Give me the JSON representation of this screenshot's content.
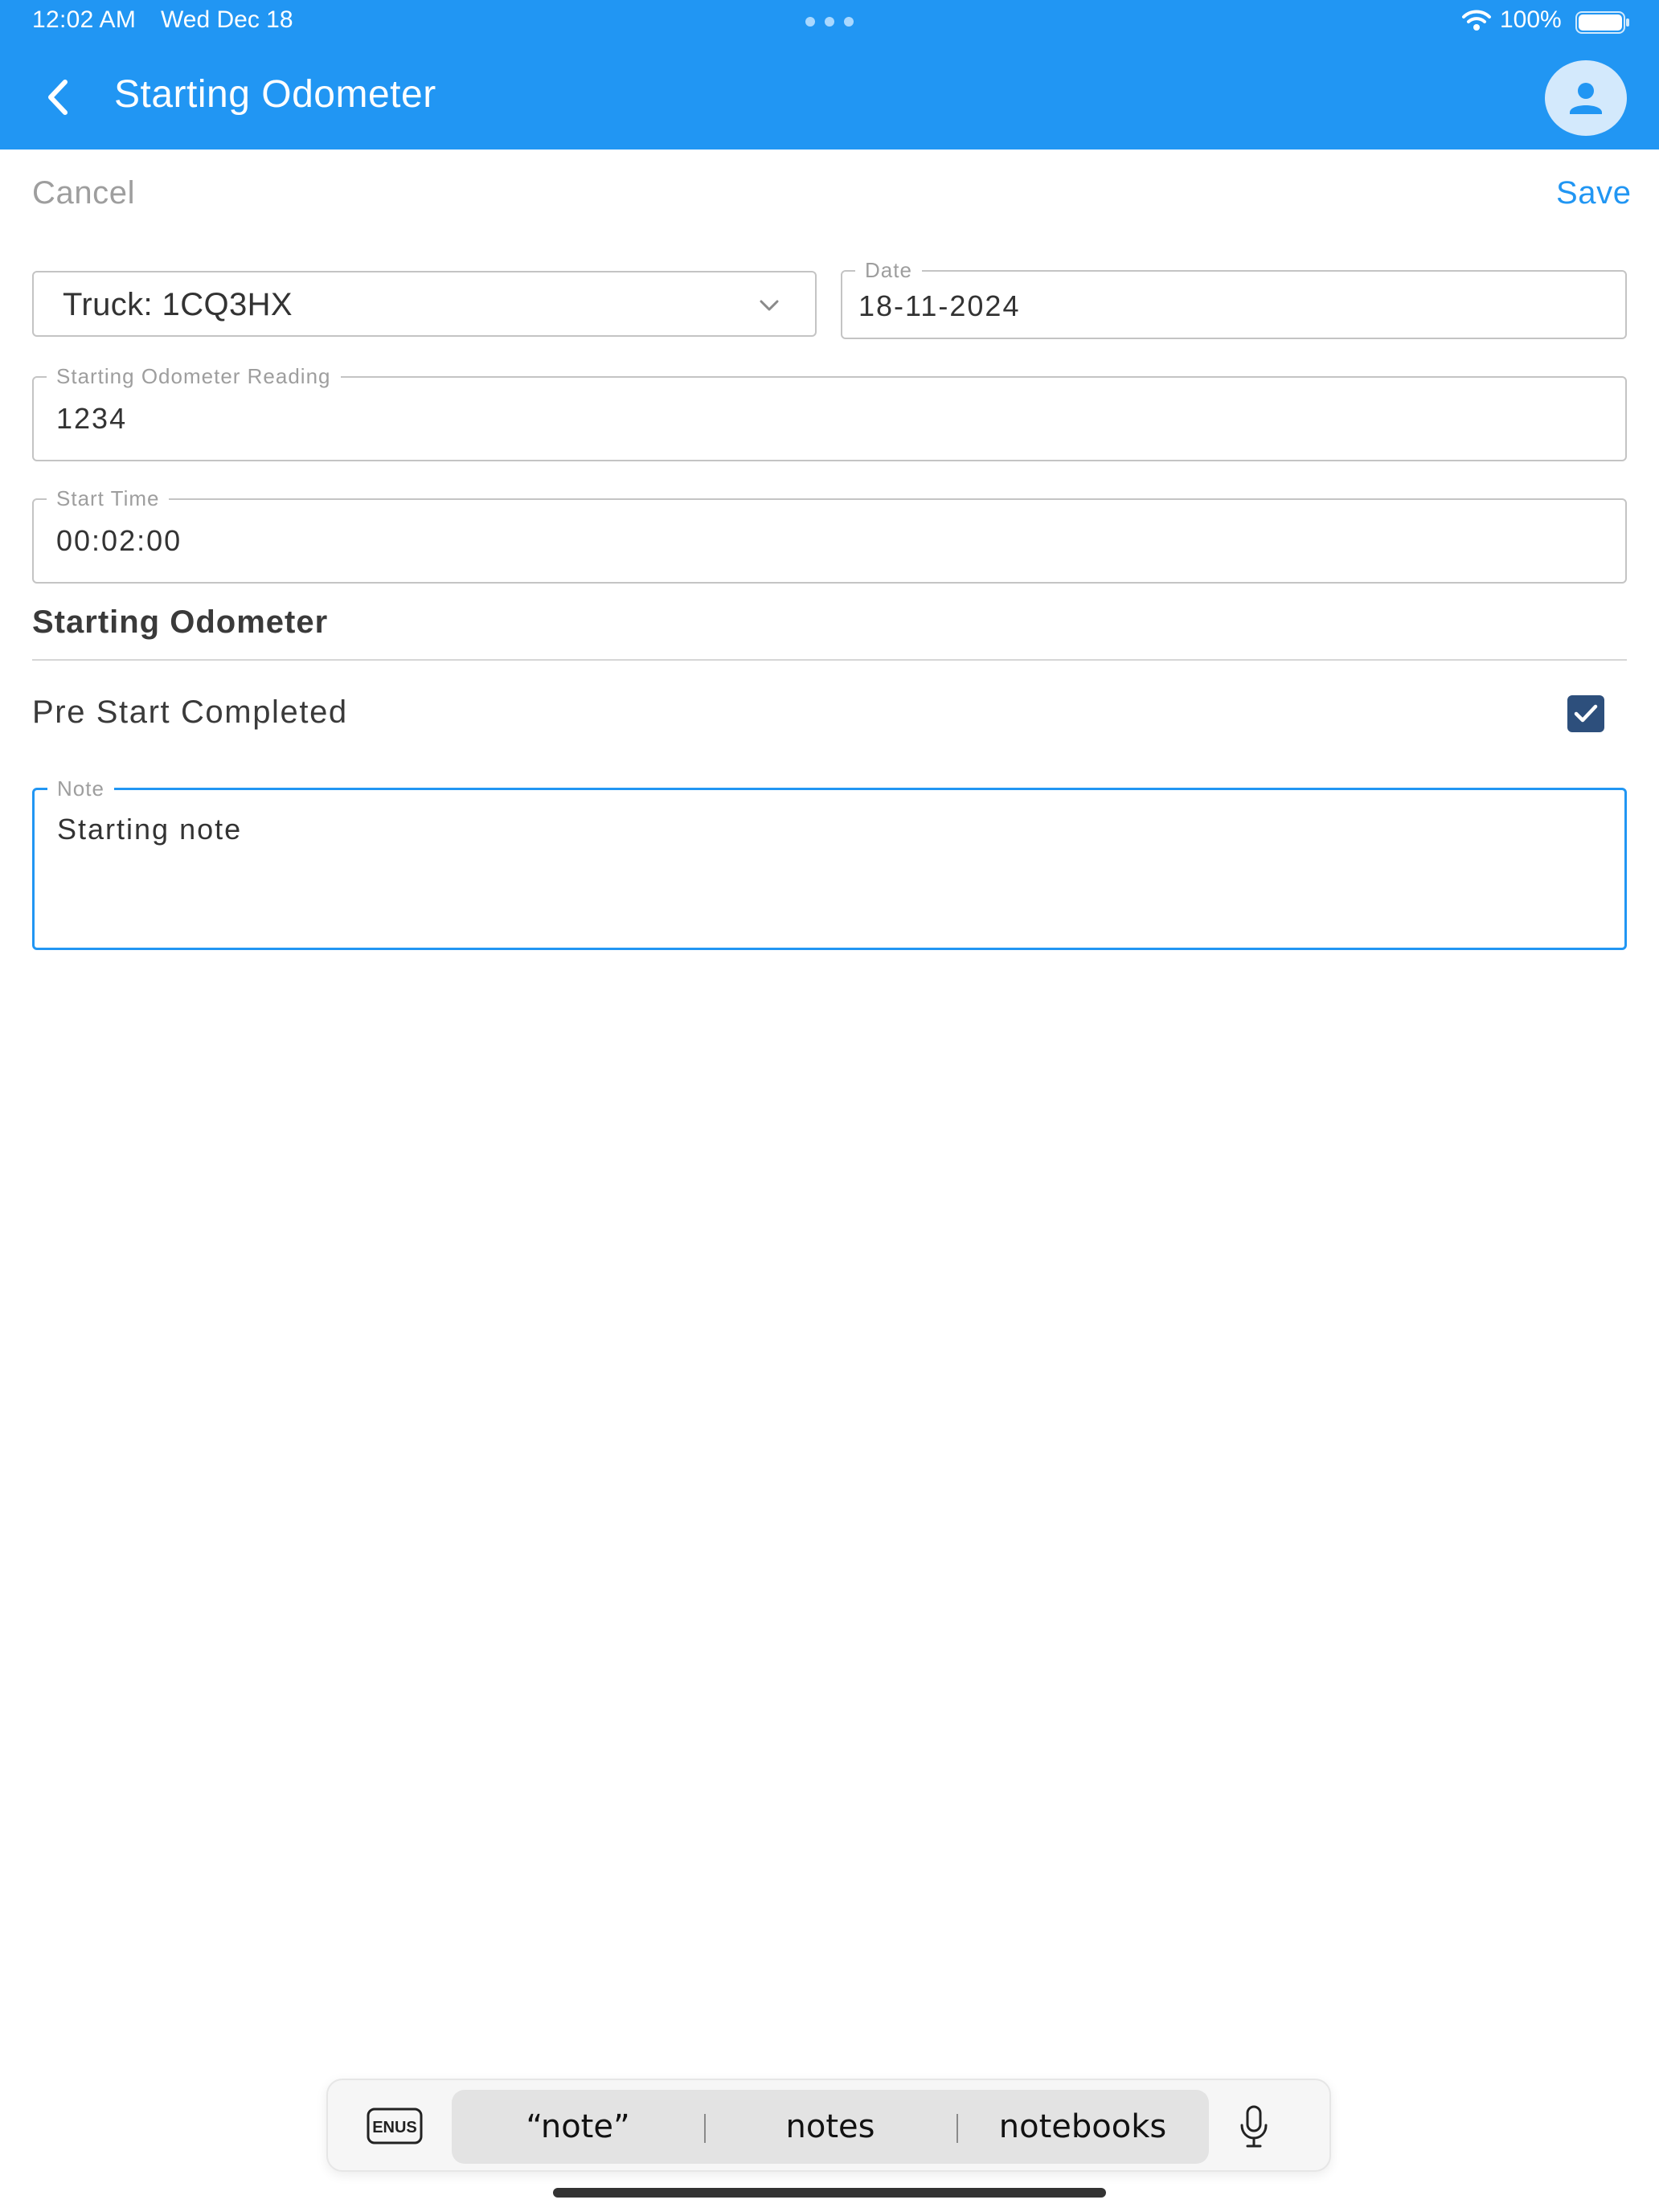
{
  "status_bar": {
    "time": "12:02 AM",
    "date": "Wed Dec 18",
    "battery_percent": "100%"
  },
  "header": {
    "title": "Starting Odometer",
    "back_icon": "chevron-left-icon",
    "profile_icon": "person-icon"
  },
  "toolbar": {
    "cancel_label": "Cancel",
    "save_label": "Save"
  },
  "form": {
    "truck_select_value": "Truck: 1CQ3HX",
    "date_label": "Date",
    "date_value": "18-11-2024",
    "odometer_label": "Starting Odometer Reading",
    "odometer_value": "1234",
    "start_time_label": "Start Time",
    "start_time_value": "00:02:00",
    "section_heading": "Starting Odometer",
    "pre_start_label": "Pre Start Completed",
    "pre_start_checked": true,
    "note_label": "Note",
    "note_value": "Starting note"
  },
  "keyboard_bar": {
    "language_badge": "ENUS",
    "suggestions": [
      "“note”",
      "notes",
      "notebooks"
    ],
    "mic_icon": "microphone-icon"
  },
  "colors": {
    "header_blue": "#2196f3",
    "checkbox_fill": "#2d4f7c",
    "cancel_gray": "#9e9e9e",
    "focus_border": "#2196f3"
  }
}
